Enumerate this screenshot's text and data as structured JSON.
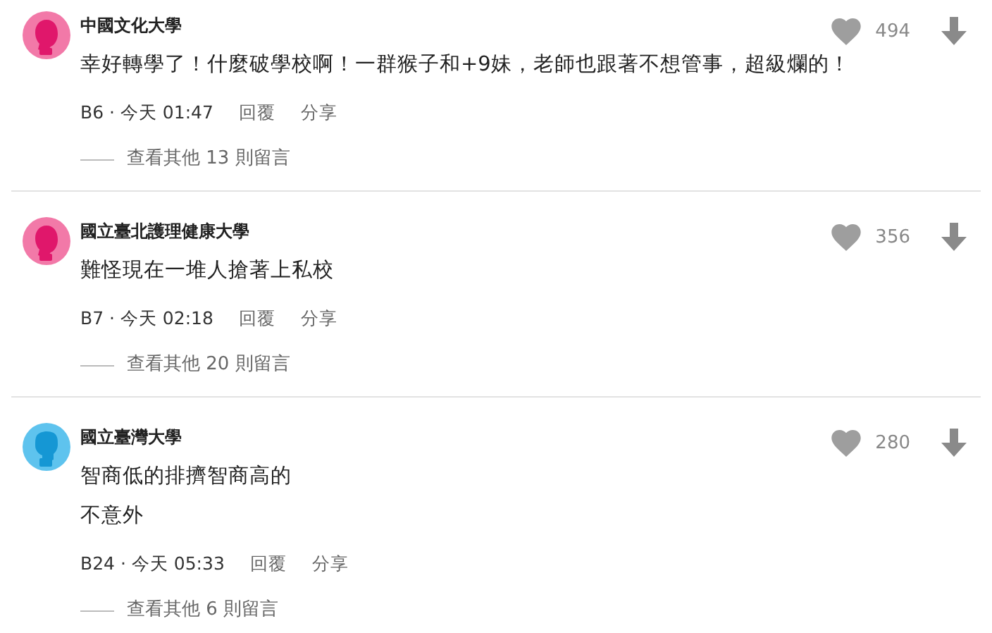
{
  "comments": [
    {
      "author": "中國文化大學",
      "avatar": {
        "kind": "female"
      },
      "likes": "494",
      "body": [
        "幸好轉學了！什麼破學校啊！一群猴子和+9妹，老師也跟著不想管事，超級爛的！"
      ],
      "stamp": "B6 · 今天 01:47",
      "reply": "回覆",
      "share": "分享",
      "more_replies": "查看其他 13 則留言"
    },
    {
      "author": "國立臺北護理健康大學",
      "avatar": {
        "kind": "female"
      },
      "likes": "356",
      "body": [
        "難怪現在一堆人搶著上私校"
      ],
      "stamp": "B7 · 今天 02:18",
      "reply": "回覆",
      "share": "分享",
      "more_replies": "查看其他 20 則留言"
    },
    {
      "author": "國立臺灣大學",
      "avatar": {
        "kind": "male"
      },
      "likes": "280",
      "body": [
        "智商低的排擠智商高的",
        "不意外"
      ],
      "stamp": "B24 · 今天 05:33",
      "reply": "回覆",
      "share": "分享",
      "more_replies": "查看其他 6 則留言"
    }
  ]
}
